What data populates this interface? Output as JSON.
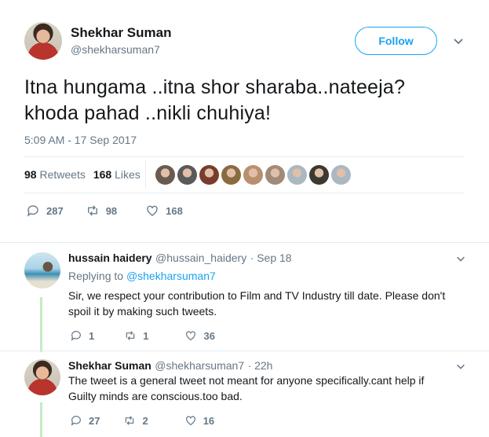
{
  "main_tweet": {
    "author_name": "Shekhar Suman",
    "author_handle": "@shekharsuman7",
    "follow_label": "Follow",
    "text_line1": "Itna hungama ..itna shor sharaba..nateeja?",
    "text_line2": "khoda pahad ..nikli chuhiya!",
    "timestamp": "5:09 AM - 17 Sep 2017",
    "retweets_count": "98",
    "retweets_label": "Retweets",
    "likes_count": "168",
    "likes_label": "Likes",
    "actions": {
      "replies": "287",
      "retweets": "98",
      "likes": "168"
    }
  },
  "likers": [
    {
      "color": "#6a5a50"
    },
    {
      "color": "#5a5a5a"
    },
    {
      "color": "#7a3c2c"
    },
    {
      "color": "#8a6a40"
    },
    {
      "color": "#b89070"
    },
    {
      "color": "#a08a7a"
    },
    {
      "color": "#aab8c2"
    },
    {
      "color": "#3a3a30"
    },
    {
      "color": "#aab8c2"
    }
  ],
  "replies": [
    {
      "author_name": "hussain haidery",
      "author_handle": "@hussain_haidery",
      "time": "· Sep 18",
      "replying_prefix": "Replying to",
      "replying_handle": "@shekharsuman7",
      "text_line1": "Sir, we respect your contribution to Film and TV Industry till date. Please don't",
      "text_line2": "spoil it by making such tweets.",
      "actions": {
        "replies": "1",
        "retweets": "1",
        "likes": "36"
      }
    },
    {
      "author_name": "Shekhar Suman",
      "author_handle": "@shekharsuman7",
      "time": "· 22h",
      "text_line1": "The tweet is a general tweet not meant for anyone specifically.cant help if",
      "text_line2": "Guilty minds are conscious.too bad.",
      "actions": {
        "replies": "27",
        "retweets": "2",
        "likes": "16"
      }
    }
  ]
}
